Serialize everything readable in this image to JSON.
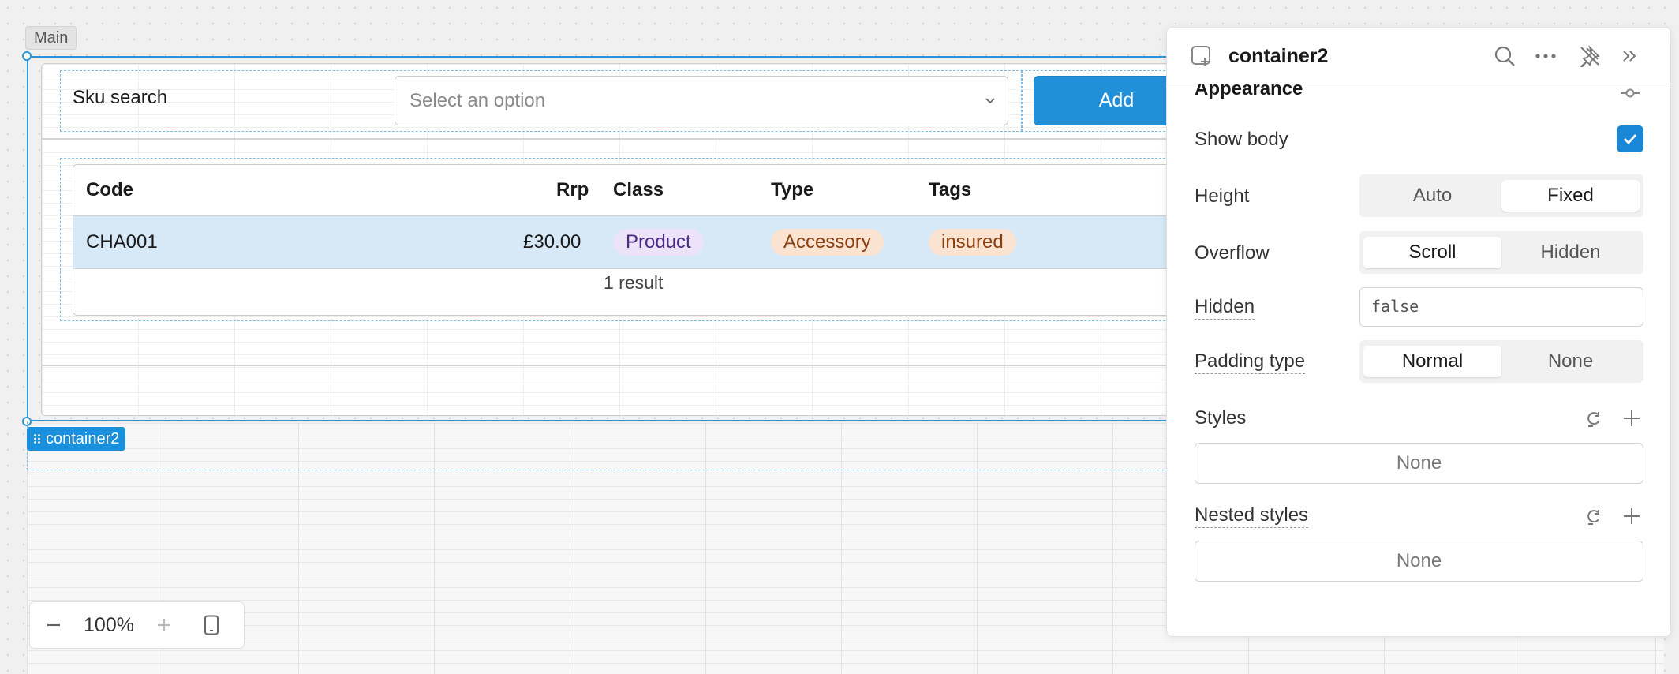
{
  "canvas": {
    "frame_label": "Main",
    "component_tag": "container2",
    "sku_label": "Sku search",
    "select_placeholder": "Select an option",
    "add_label": "Add",
    "table": {
      "headers": [
        "Code",
        "Rrp",
        "Class",
        "Type",
        "Tags"
      ],
      "row": {
        "code": "CHA001",
        "rrp": "£30.00",
        "class": "Product",
        "type": "Accessory",
        "tags": "insured"
      },
      "footer": "1 result"
    },
    "zoom_value": "100%"
  },
  "inspector": {
    "title": "container2",
    "section_appearance": "Appearance",
    "show_body_label": "Show body",
    "show_body_checked": true,
    "height_label": "Height",
    "height_options": [
      "Auto",
      "Fixed"
    ],
    "height_selected": "Fixed",
    "overflow_label": "Overflow",
    "overflow_options": [
      "Scroll",
      "Hidden"
    ],
    "overflow_selected": "Scroll",
    "hidden_label": "Hidden",
    "hidden_value": "false",
    "padding_label": "Padding type",
    "padding_options": [
      "Normal",
      "None"
    ],
    "padding_selected": "Normal",
    "styles_label": "Styles",
    "styles_value": "None",
    "nested_styles_label": "Nested styles",
    "nested_styles_value": "None"
  },
  "colors": {
    "accent": "#2290d8",
    "selection": "#2b95d9",
    "row_highlight": "#d7e8f6",
    "pill_product_bg": "#ece3f8",
    "pill_product_fg": "#4a2a86",
    "pill_accessory_bg": "#fbe3d2",
    "pill_accessory_fg": "#8a3f12",
    "pill_insured_bg": "#fbe3d2",
    "pill_insured_fg": "#8a3f12"
  }
}
